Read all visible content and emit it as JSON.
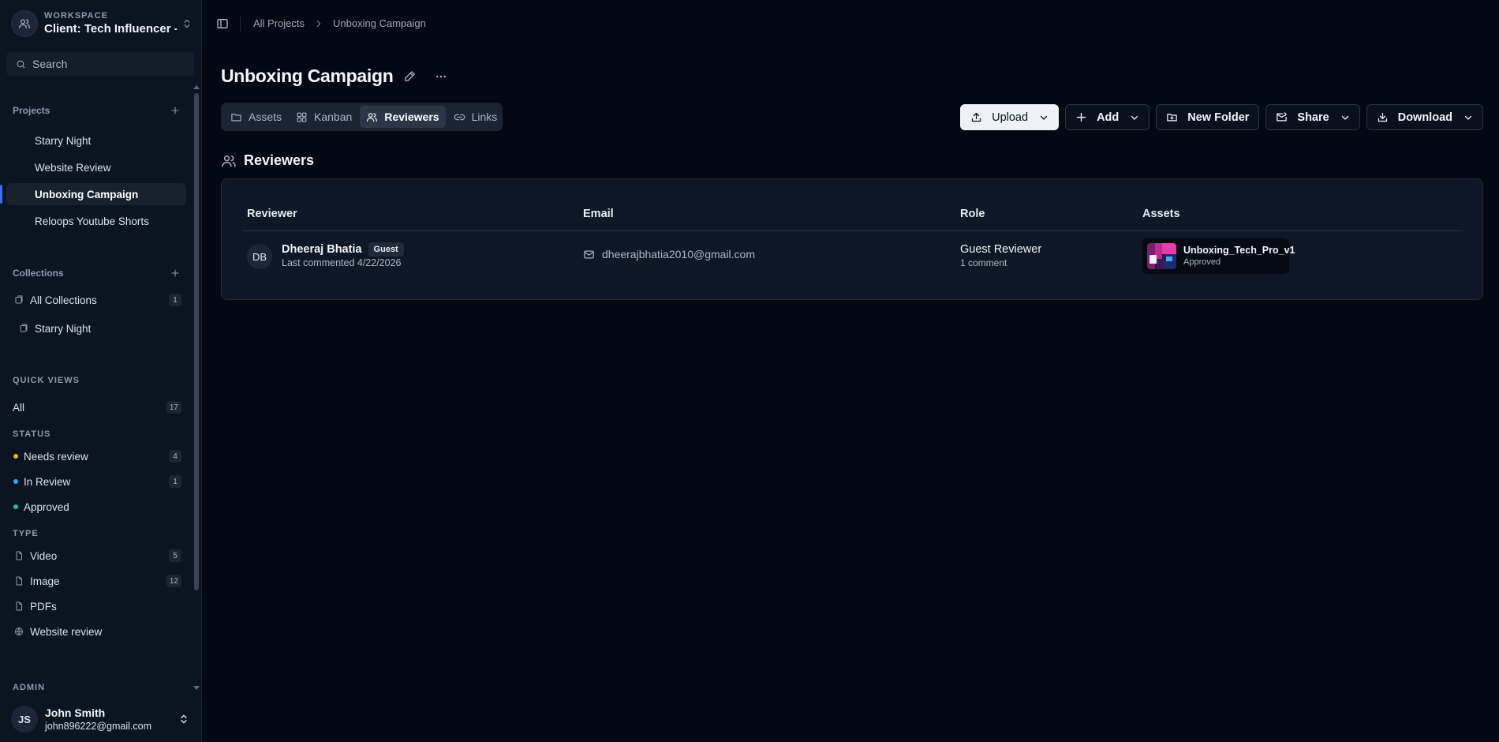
{
  "workspace": {
    "label": "WORKSPACE",
    "name": "Client: Tech Influencer -..."
  },
  "search": {
    "placeholder": "Search"
  },
  "projects": {
    "heading": "Projects",
    "items": [
      {
        "label": "Starry Night",
        "active": false
      },
      {
        "label": "Website Review",
        "active": false
      },
      {
        "label": "Unboxing Campaign",
        "active": true
      },
      {
        "label": "Reloops Youtube Shorts",
        "active": false
      }
    ]
  },
  "collections": {
    "heading": "Collections",
    "items": [
      {
        "label": "All Collections",
        "count": "1"
      },
      {
        "label": "Starry Night",
        "count": ""
      }
    ]
  },
  "quick_views": {
    "heading": "QUICK VIEWS",
    "all": {
      "label": "All",
      "count": "17"
    },
    "status_heading": "STATUS",
    "status": [
      {
        "label": "Needs review",
        "count": "4",
        "color": "#f5b014"
      },
      {
        "label": "In Review",
        "count": "1",
        "color": "#38a4f2"
      },
      {
        "label": "Approved",
        "count": "",
        "color": "#22c58b"
      }
    ],
    "type_heading": "TYPE",
    "types": [
      {
        "label": "Video",
        "count": "5",
        "icon": "file-icon"
      },
      {
        "label": "Image",
        "count": "12",
        "icon": "file-icon"
      },
      {
        "label": "PDFs",
        "count": "",
        "icon": "file-icon"
      },
      {
        "label": "Website review",
        "count": "",
        "icon": "globe-icon"
      }
    ]
  },
  "admin": {
    "heading": "ADMIN"
  },
  "user": {
    "initials": "JS",
    "name": "John Smith",
    "email": "john896222@gmail.com"
  },
  "breadcrumb": {
    "root": "All Projects",
    "current": "Unboxing Campaign"
  },
  "page": {
    "title": "Unboxing Campaign"
  },
  "tabs": [
    {
      "label": "Assets",
      "icon": "folder-icon",
      "active": false
    },
    {
      "label": "Kanban",
      "icon": "grid-icon",
      "active": false
    },
    {
      "label": "Reviewers",
      "icon": "users-icon",
      "active": true
    },
    {
      "label": "Links",
      "icon": "link-icon",
      "active": false
    }
  ],
  "actions": {
    "upload": "Upload",
    "add": "Add",
    "new_folder": "New Folder",
    "share": "Share",
    "download": "Download"
  },
  "reviewers_section": {
    "title": "Reviewers",
    "columns": {
      "reviewer": "Reviewer",
      "email": "Email",
      "role": "Role",
      "assets": "Assets"
    },
    "rows": [
      {
        "initials": "DB",
        "name": "Dheeraj Bhatia",
        "badge": "Guest",
        "last_commented": "Last commented 4/22/2026",
        "email": "dheerajbhatia2010@gmail.com",
        "role": "Guest Reviewer",
        "comments": "1 comment",
        "asset_name": "Unboxing_Tech_Pro_v1",
        "asset_status": "Approved"
      }
    ]
  },
  "colors": {
    "background": "#040812",
    "sidebar": "#0c1422",
    "accent": "#3b6cf6"
  }
}
